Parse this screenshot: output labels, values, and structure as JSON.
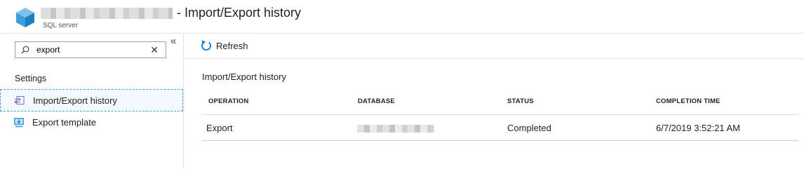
{
  "header": {
    "title": "- Import/Export history",
    "subtitle": "SQL server",
    "icon": "sql-server-cube-icon"
  },
  "sidebar": {
    "search": {
      "value": "export",
      "placeholder": ""
    },
    "section_label": "Settings",
    "items": [
      {
        "label": "Import/Export history",
        "icon": "import-export-icon",
        "selected": true
      },
      {
        "label": "Export template",
        "icon": "export-template-icon",
        "selected": false
      }
    ]
  },
  "toolbar": {
    "refresh_label": "Refresh"
  },
  "main": {
    "section_title": "Import/Export history",
    "columns": [
      "OPERATION",
      "DATABASE",
      "STATUS",
      "COMPLETION TIME"
    ],
    "rows": [
      {
        "operation": "Export",
        "database": "",
        "status": "Completed",
        "completion_time": "6/7/2019 3:52:21 AM"
      }
    ]
  },
  "colors": {
    "accent": "#0078d4",
    "selection_border": "#4a9fd8"
  }
}
